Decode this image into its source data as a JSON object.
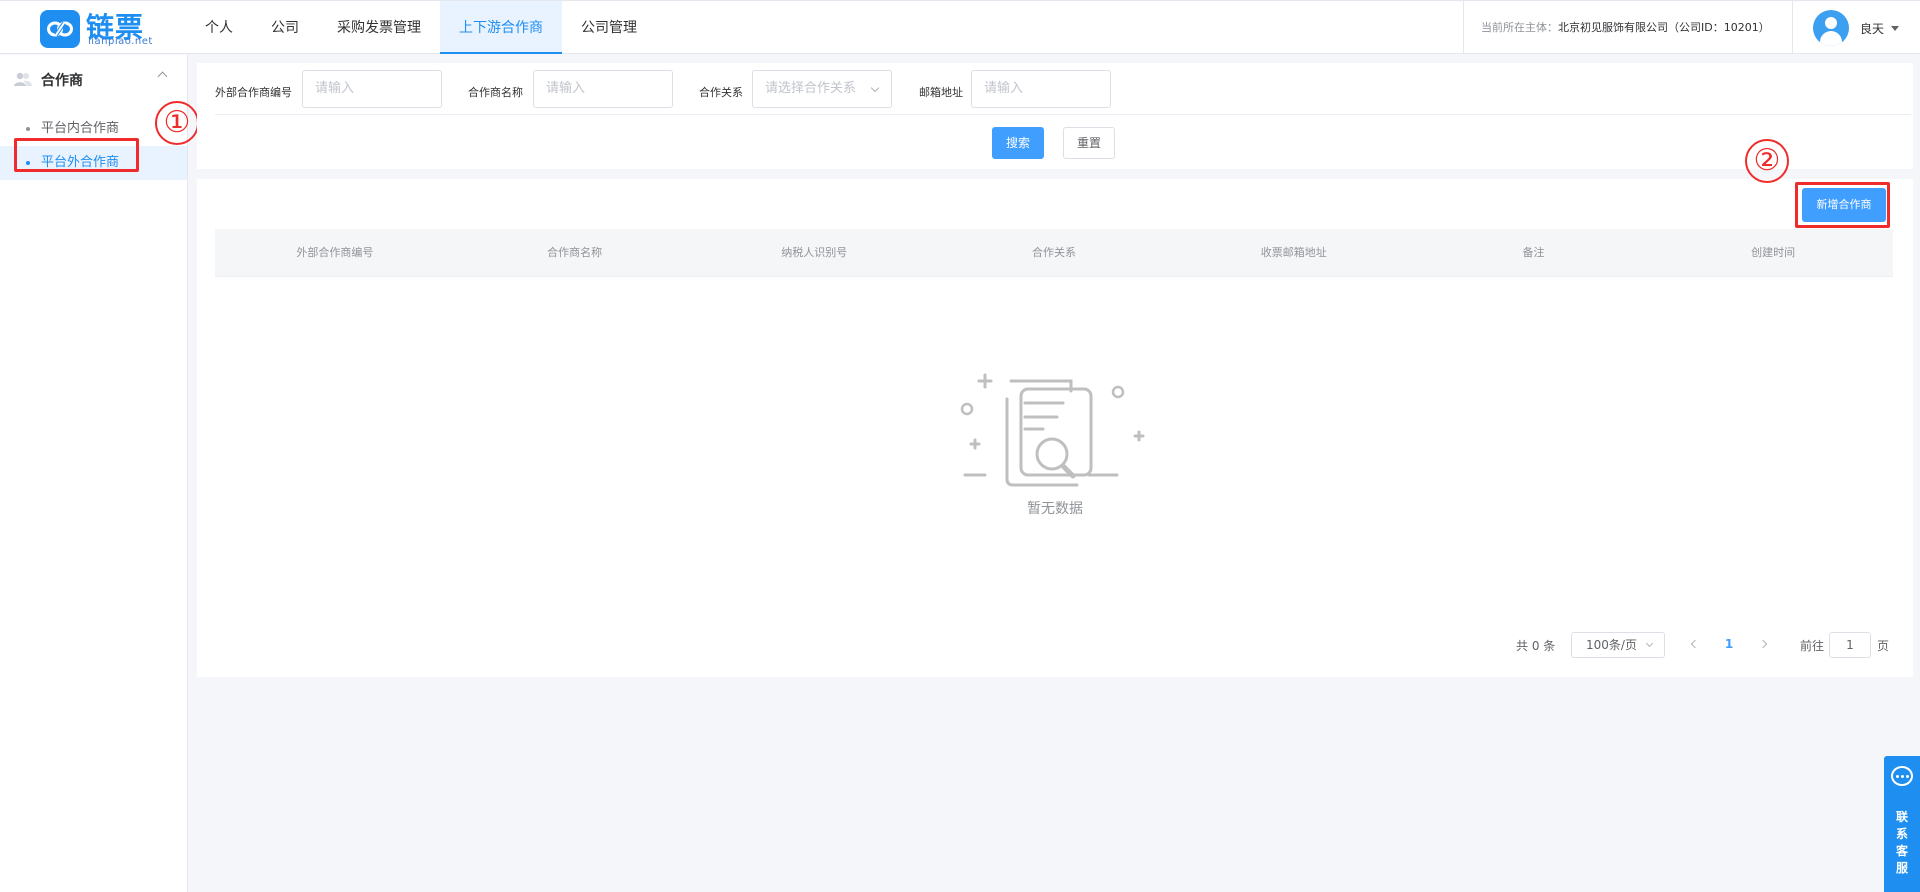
{
  "brand": {
    "title": "链票",
    "subtitle": "lianpiao.net",
    "color": "#1f8ef1"
  },
  "nav": [
    {
      "label": "个人",
      "active": false
    },
    {
      "label": "公司",
      "active": false
    },
    {
      "label": "采购发票管理",
      "active": false
    },
    {
      "label": "上下游合作商",
      "active": true
    },
    {
      "label": "公司管理",
      "active": false
    }
  ],
  "header": {
    "entity_prefix": "当前所在主体：",
    "entity_value": "北京初见服饰有限公司（公司ID：10201）",
    "user_name": "良天"
  },
  "sidebar": {
    "group_title": "合作商",
    "items": [
      {
        "label": "平台内合作商",
        "active": false
      },
      {
        "label": "平台外合作商",
        "active": true
      }
    ]
  },
  "annotations": {
    "marker1": "①",
    "marker2": "②",
    "highlight_color": "#ef2b2b"
  },
  "filters": {
    "external_id": {
      "label": "外部合作商编号",
      "placeholder": "请输入"
    },
    "partner_name": {
      "label": "合作商名称",
      "placeholder": "请输入"
    },
    "relation": {
      "label": "合作关系",
      "placeholder": "请选择合作关系"
    },
    "email": {
      "label": "邮箱地址",
      "placeholder": "请输入"
    },
    "search_label": "搜索",
    "reset_label": "重置"
  },
  "table": {
    "add_label": "新增合作商",
    "columns": [
      "外部合作商编号",
      "合作商名称",
      "纳税人识别号",
      "合作关系",
      "收票邮箱地址",
      "备注",
      "创建时间"
    ],
    "rows": [],
    "empty_text": "暂无数据"
  },
  "pagination": {
    "total_text": "共 0 条",
    "page_size": "100条/页",
    "current_page": "1",
    "goto_label": "前往",
    "goto_value": "1",
    "page_suffix": "页"
  },
  "contact": {
    "label": "联系客服"
  },
  "colors": {
    "primary": "#409eff",
    "accent": "#1f8ef1"
  }
}
